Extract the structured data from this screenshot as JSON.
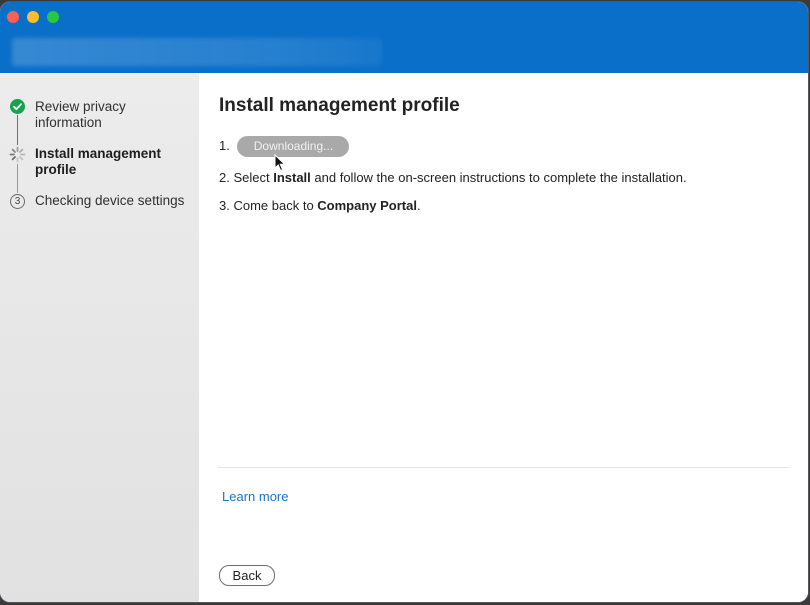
{
  "sidebar": {
    "steps": [
      {
        "label": "Review privacy information",
        "state": "complete",
        "icon": "check-icon"
      },
      {
        "label": "Install management profile",
        "state": "in-progress",
        "icon": "spinner-icon"
      },
      {
        "label": "Checking device settings",
        "state": "pending",
        "icon": "3"
      }
    ]
  },
  "main": {
    "title": "Install management profile",
    "instructions": {
      "step1_num": "1.",
      "download_button": "Downloading...",
      "step2_num": "2.",
      "step2_pre": "Select ",
      "step2_bold": "Install",
      "step2_post": " and follow the on-screen instructions to complete the installation.",
      "step3_num": "3.",
      "step3_pre": "Come back to ",
      "step3_bold": "Company Portal",
      "step3_post": "."
    },
    "learn_more": "Learn more",
    "back_button": "Back"
  },
  "colors": {
    "titlebar": "#0a6fc9",
    "accent": "#1a73c8",
    "complete": "#17a34a"
  }
}
